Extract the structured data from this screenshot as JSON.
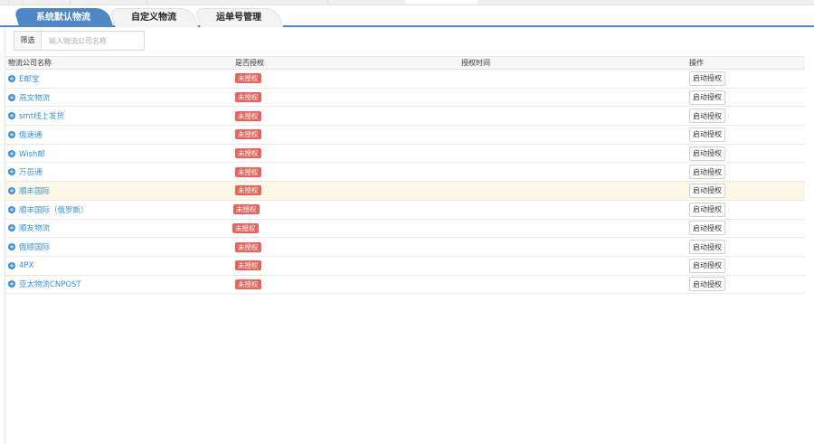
{
  "tabs": [
    {
      "label": "系统默认物流"
    },
    {
      "label": "自定义物流"
    },
    {
      "label": "运单号管理"
    }
  ],
  "filter": {
    "label": "筛选",
    "placeholder": "输入物流公司名称"
  },
  "table": {
    "columns": [
      "物流公司名称",
      "是否授权",
      "授权时间",
      "操作"
    ],
    "rows": [
      {
        "name": "E邮宝",
        "status": "未授权",
        "time": "",
        "action": "启动授权"
      },
      {
        "name": "燕文物流",
        "status": "未授权",
        "time": "",
        "action": "启动授权"
      },
      {
        "name": "smt线上发货",
        "status": "未授权",
        "time": "",
        "action": "启动授权"
      },
      {
        "name": "俄速通",
        "status": "未授权",
        "time": "",
        "action": "启动授权"
      },
      {
        "name": "Wish邮",
        "status": "未授权",
        "time": "",
        "action": "启动授权"
      },
      {
        "name": "万邑通",
        "status": "未授权",
        "time": "",
        "action": "启动授权"
      },
      {
        "name": "顺丰国际",
        "status": "未授权",
        "time": "",
        "action": "启动授权"
      },
      {
        "name": "顺丰国际（俄罗斯）",
        "status": "未授权",
        "time": "",
        "action": "启动授权"
      },
      {
        "name": "顺友物流",
        "status": "未授权",
        "time": "",
        "action": "启动授权"
      },
      {
        "name": "俄顺国际",
        "status": "未授权",
        "time": "",
        "action": "启动授权"
      },
      {
        "name": "4PX",
        "status": "未授权",
        "time": "",
        "action": "启动授权"
      },
      {
        "name": "亚太物流CNPOST",
        "status": "未授权",
        "time": "",
        "action": "启动授权"
      }
    ]
  },
  "colors": {
    "accent": "#4f86c6",
    "link": "#3a8fd6",
    "badge": "#e5645c",
    "highlight_row": "#fdf8e6"
  }
}
